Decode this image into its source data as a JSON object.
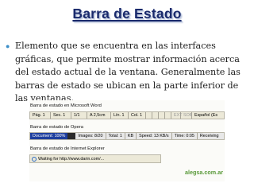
{
  "slide": {
    "title": "Barra de Estado",
    "bullet_text": "Elemento que se encuentra en las interfaces gráficas, que permite mostrar información acerca del estado actual de la ventana. Generalmente las barras de estado se ubican en la parte inferior de las ventanas."
  },
  "screenshot": {
    "word_caption": "Barra de estado en Microsoft Word",
    "word_cells": [
      "Pág. 1",
      "Sec. 1",
      "1/1",
      "A 2,5cm",
      "Lín. 1",
      "Col. 1",
      "",
      "",
      "",
      "",
      "EXT",
      "SOB",
      "Español (Es"
    ],
    "opera_caption": "Barra de estado de Opera",
    "opera_progress": "Document: 100%",
    "opera_cells": [
      "Images: 8/20",
      "Total: 1",
      "KB",
      "Speed: 13 KB/s",
      "Time: 0:05",
      "Receiving"
    ],
    "ie_caption": "Barra de estado de Internet Explorer",
    "ie_text": "Waiting for http://www.darin.com/...",
    "credit": "alegsa.com.ar"
  }
}
